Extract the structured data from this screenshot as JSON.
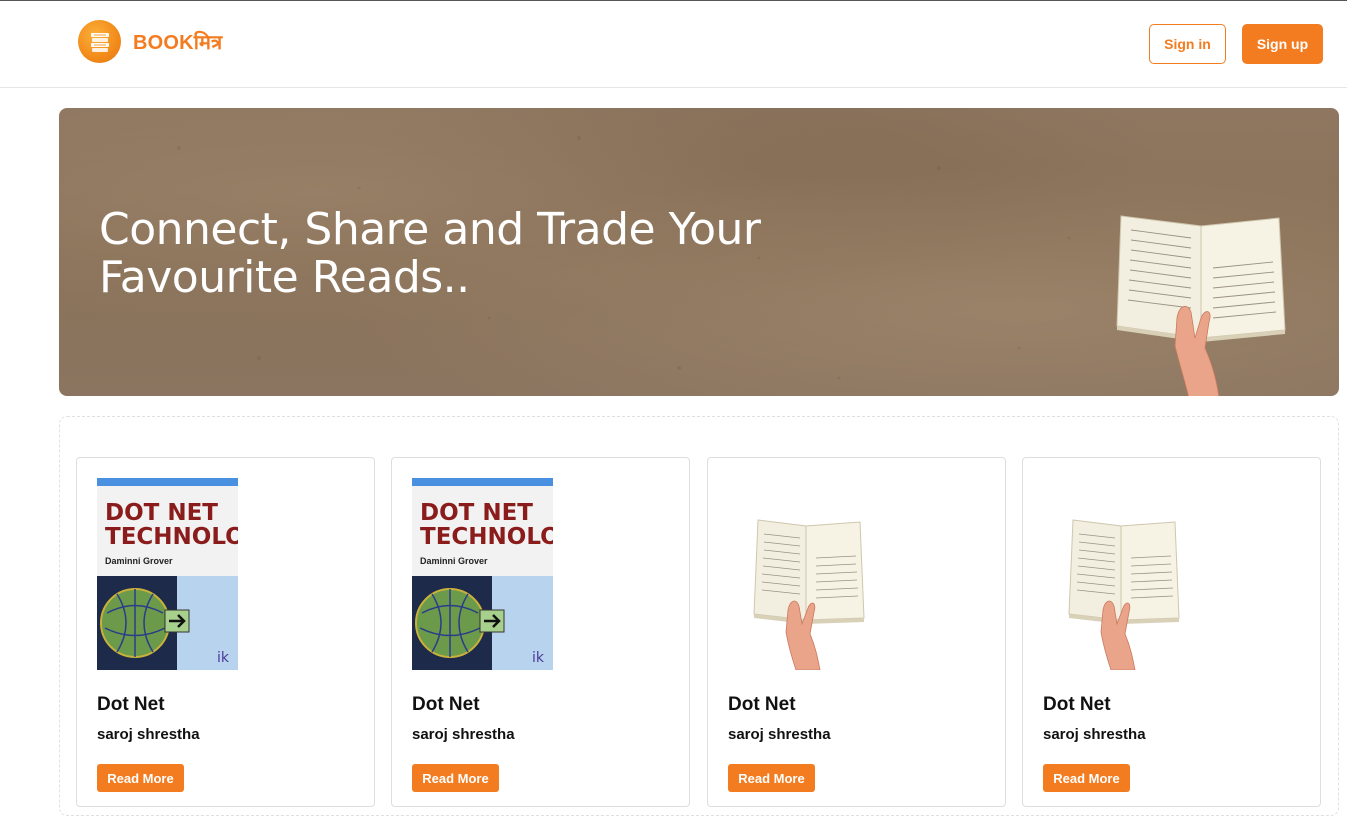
{
  "header": {
    "brand": "BOOKमित्र",
    "signin_label": "Sign in",
    "signup_label": "Sign up"
  },
  "hero": {
    "line1": "Connect, Share and Trade Your",
    "line2": "Favourite Reads.."
  },
  "books": [
    {
      "cover": "dotnet",
      "cover_title_1": "DOT NET",
      "cover_title_2": "TECHNOLOGY",
      "cover_author": "Daminni Grover",
      "title": "Dot Net",
      "author": "saroj shrestha",
      "action": "Read More"
    },
    {
      "cover": "dotnet",
      "cover_title_1": "DOT NET",
      "cover_title_2": "TECHNOLOGY",
      "cover_author": "Daminni Grover",
      "title": "Dot Net",
      "author": "saroj shrestha",
      "action": "Read More"
    },
    {
      "cover": "open-book",
      "title": "Dot Net",
      "author": "saroj shrestha",
      "action": "Read More"
    },
    {
      "cover": "open-book",
      "title": "Dot Net",
      "author": "saroj shrestha",
      "action": "Read More"
    }
  ],
  "colors": {
    "accent": "#f47c20",
    "hero_bg": "#8b7560",
    "border": "#dedede"
  },
  "icons": {
    "logo": "stacked-books-icon"
  }
}
